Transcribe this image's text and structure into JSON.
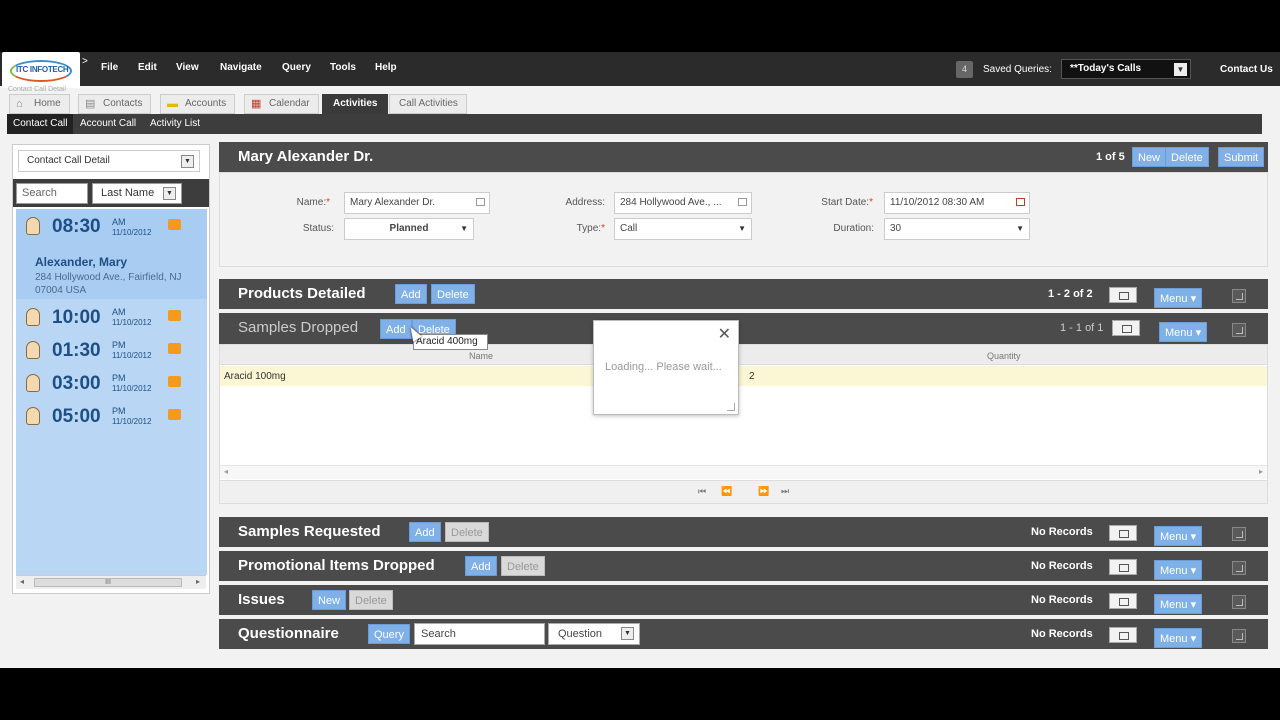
{
  "logo_text": "ITC INFOTECH",
  "breadcrumb": "Contact Call Detail",
  "menu": [
    "File",
    "Edit",
    "View",
    "Navigate",
    "Query",
    "Tools",
    "Help"
  ],
  "saved_queries": {
    "count": "4",
    "label": "Saved Queries:",
    "selected": "**Today's Calls"
  },
  "contact_us": "Contact Us",
  "tabs": [
    {
      "label": "Home",
      "icon": "home-icon"
    },
    {
      "label": "Contacts",
      "icon": "contacts-icon"
    },
    {
      "label": "Accounts",
      "icon": "folder-icon"
    },
    {
      "label": "Calendar",
      "icon": "calendar-icon"
    },
    {
      "label": "Activities",
      "active": true
    },
    {
      "label": "Call Activities"
    }
  ],
  "subnav": [
    "Contact Call",
    "Account Call",
    "Activity List"
  ],
  "left": {
    "view_select": "Contact Call Detail",
    "search_placeholder": "Search",
    "sort": "Last Name",
    "selected": {
      "name": "Alexander, Mary",
      "address": "284 Hollywood Ave., Fairfield, NJ 07004 USA"
    },
    "calls": [
      {
        "time": "08:30",
        "ampm": "AM",
        "date": "11/10/2012"
      },
      {
        "time": "10:00",
        "ampm": "AM",
        "date": "11/10/2012"
      },
      {
        "time": "01:30",
        "ampm": "PM",
        "date": "11/10/2012"
      },
      {
        "time": "03:00",
        "ampm": "PM",
        "date": "11/10/2012"
      },
      {
        "time": "05:00",
        "ampm": "PM",
        "date": "11/10/2012"
      }
    ],
    "scroll_thumb": "III"
  },
  "record": {
    "title": "Mary Alexander Dr.",
    "count": "1 of 5",
    "buttons": {
      "new": "New",
      "delete": "Delete",
      "submit": "Submit"
    },
    "fields": {
      "name_label": "Name:",
      "name": "Mary Alexander Dr.",
      "address_label": "Address:",
      "address": "284 Hollywood Ave., ...",
      "start_label": "Start Date:",
      "start": "11/10/2012 08:30 AM",
      "status_label": "Status:",
      "status": "Planned",
      "type_label": "Type:",
      "type": "Call",
      "duration_label": "Duration:",
      "duration": "30"
    }
  },
  "products": {
    "title": "Products Detailed",
    "add": "Add",
    "delete": "Delete",
    "count": "1 - 2 of 2",
    "menu": "Menu"
  },
  "samples": {
    "title": "Samples Dropped",
    "add": "Add",
    "delete": "Delete",
    "count": "1 - 1 of 1",
    "menu": "Menu",
    "col_name": "Name",
    "col_qty": "Quantity",
    "row": {
      "name": "Aracid 100mg",
      "qty": "2"
    },
    "tooltip": "Aracid 400mg"
  },
  "dialog": {
    "message": "Loading... Please wait..."
  },
  "requested": {
    "title": "Samples Requested",
    "add": "Add",
    "delete": "Delete",
    "count": "No Records",
    "menu": "Menu"
  },
  "promo": {
    "title": "Promotional Items Dropped",
    "add": "Add",
    "delete": "Delete",
    "count": "No Records",
    "menu": "Menu"
  },
  "issues": {
    "title": "Issues",
    "new": "New",
    "delete": "Delete",
    "count": "No Records",
    "menu": "Menu"
  },
  "questionnaire": {
    "title": "Questionnaire",
    "query": "Query",
    "search_placeholder": "Search",
    "select": "Question",
    "count": "No Records",
    "menu": "Menu"
  },
  "colors": {
    "topbar": "#2b2b2b",
    "section": "#4b4b4b",
    "button": "#7fb0e8",
    "list": "#b9d7f4",
    "accent_flag": "#f39a1f"
  }
}
